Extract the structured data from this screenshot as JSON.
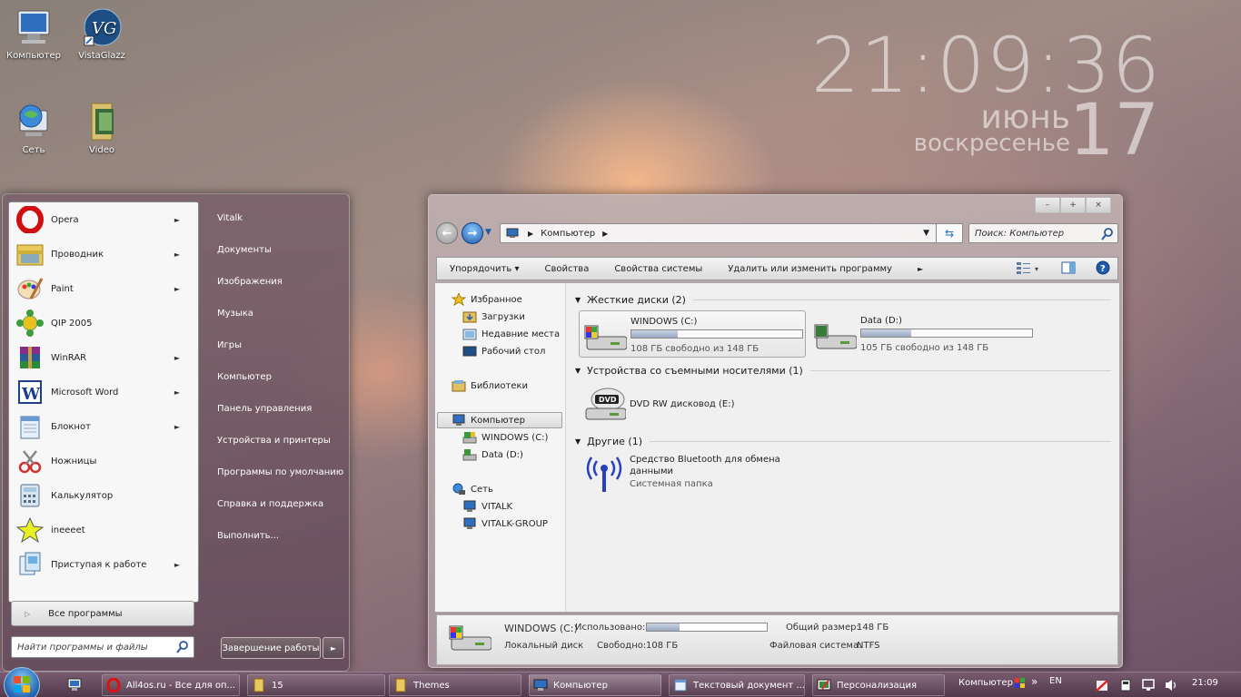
{
  "desktop": {
    "icons": [
      {
        "label": "Компьютер"
      },
      {
        "label": "VistaGlazz"
      },
      {
        "label": "Сеть"
      },
      {
        "label": "Video"
      }
    ]
  },
  "clock": {
    "time": "21:09:36",
    "month": "июнь",
    "weekday": "воскресенье",
    "day": "17"
  },
  "start_menu": {
    "programs": [
      {
        "label": "Opera",
        "icon": "opera-icon",
        "arrow": "►"
      },
      {
        "label": "Проводник",
        "icon": "explorer-icon",
        "arrow": "►"
      },
      {
        "label": "Paint",
        "icon": "paint-icon",
        "arrow": "►"
      },
      {
        "label": "QIP 2005",
        "icon": "qip-icon",
        "arrow": ""
      },
      {
        "label": "WinRAR",
        "icon": "winrar-icon",
        "arrow": "►"
      },
      {
        "label": "Microsoft Word",
        "icon": "word-icon",
        "arrow": "►"
      },
      {
        "label": "Блокнот",
        "icon": "notepad-icon",
        "arrow": "►"
      },
      {
        "label": "Ножницы",
        "icon": "scissors-icon",
        "arrow": ""
      },
      {
        "label": "Калькулятор",
        "icon": "calculator-icon",
        "arrow": ""
      },
      {
        "label": "ineeeet",
        "icon": "star-icon",
        "arrow": ""
      },
      {
        "label": "Приступая к работе",
        "icon": "getting-started-icon",
        "arrow": "►"
      }
    ],
    "all_programs": "Все программы",
    "search_placeholder": "Найти программы и файлы",
    "right_items": [
      {
        "label": "Vitalk"
      },
      {
        "label": "Документы"
      },
      {
        "label": "Изображения"
      },
      {
        "label": "Музыка"
      },
      {
        "label": "Игры"
      },
      {
        "label": "Компьютер"
      },
      {
        "label": "Панель управления"
      },
      {
        "label": "Устройства и принтеры"
      },
      {
        "label": "Программы по умолчанию"
      },
      {
        "label": "Справка и поддержка"
      },
      {
        "label": "Выполнить..."
      }
    ],
    "shutdown_label": "Завершение работы",
    "shutdown_arrow": "►"
  },
  "explorer": {
    "window_buttons": {
      "minimize": "–",
      "maximize": "+",
      "close": "×"
    },
    "address_root": "Компьютер",
    "search_placeholder": "Поиск: Компьютер",
    "toolbar": {
      "organize": "Упорядочить ▾",
      "properties": "Свойства",
      "system_properties": "Свойства системы",
      "uninstall": "Удалить или изменить программу",
      "more": "►"
    },
    "nav_pane": {
      "favorites": "Избранное",
      "downloads": "Загрузки",
      "recent": "Недавние места",
      "desktop": "Рабочий стол",
      "libraries": "Библиотеки",
      "computer": "Компьютер",
      "drive_c": "WINDOWS (C:)",
      "drive_d": "Data (D:)",
      "network": "Сеть",
      "vitalk": "VITALK",
      "vitalk_group": "VITALK-GROUP"
    },
    "groups": {
      "hard_drives": "Жесткие диски (2)",
      "removable": "Устройства со съемными носителями (1)",
      "other": "Другие (1)"
    },
    "drives": [
      {
        "name": "WINDOWS (C:)",
        "free_text": "108 ГБ свободно из 148 ГБ",
        "used_fraction": 0.27
      },
      {
        "name": "Data (D:)",
        "free_text": "105 ГБ свободно из 148 ГБ",
        "used_fraction": 0.29
      }
    ],
    "dvd": {
      "name": "DVD RW дисковод (E:)",
      "badge": "DVD"
    },
    "bluetooth": {
      "name": "Средство Bluetooth для обмена данными",
      "type": "Системная папка"
    },
    "details": {
      "name": "WINDOWS (C:)",
      "type": "Локальный диск",
      "used_label": "Использовано:",
      "used_fraction": 0.27,
      "free_label": "Свободно:",
      "free_value": "108 ГБ",
      "total_label": "Общий размер:",
      "total_value": "148 ГБ",
      "fs_label": "Файловая система:",
      "fs_value": "NTFS"
    }
  },
  "taskbar": {
    "tasks": [
      {
        "label": "All4os.ru - Все для оп..."
      },
      {
        "label": "15"
      },
      {
        "label": "Themes"
      },
      {
        "label": "Компьютер"
      },
      {
        "label": "Текстовый документ ..."
      },
      {
        "label": "Персонализация"
      }
    ],
    "toolbar_label": "Компьютер",
    "chevron": "»",
    "language": "EN",
    "time": "21:09"
  }
}
